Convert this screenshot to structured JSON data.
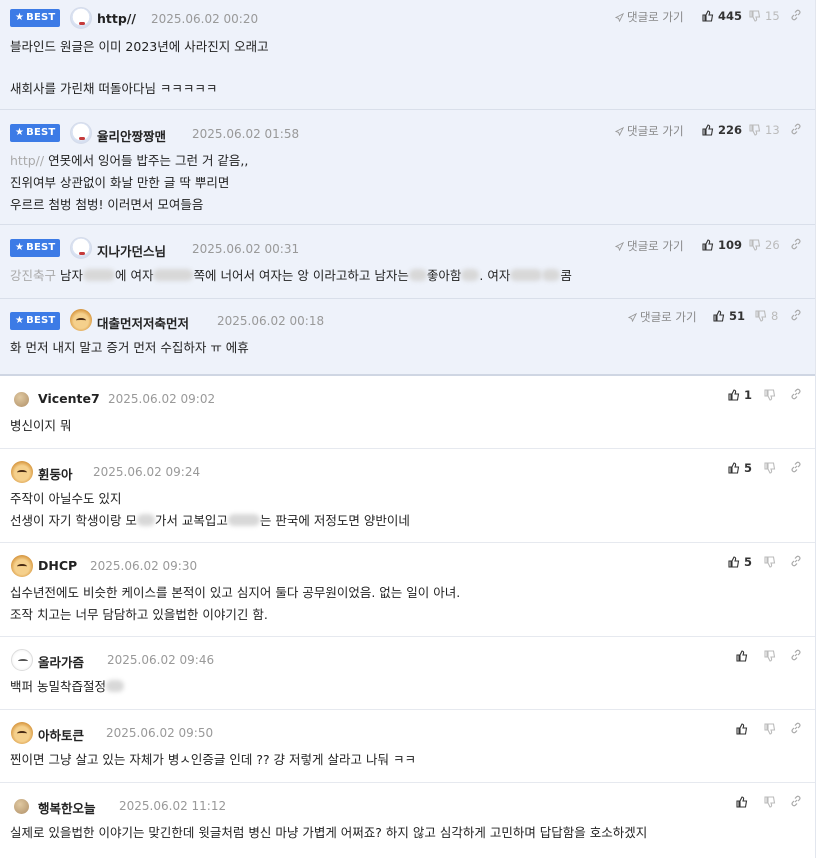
{
  "ui": {
    "best_label": "BEST",
    "reply_label": "댓글로 가기"
  },
  "colors": {
    "best_bg": "#eef2fa",
    "badge": "#3c7be6",
    "separator": "#e6e9ef"
  },
  "best_comments": [
    {
      "nick": "http//",
      "date": "2025.06.02 00:20",
      "likes": "445",
      "dislikes": "15",
      "avatar": "bear",
      "lines": [
        "블라인드 원글은 이미 2023년에 사라진지 오래고",
        "",
        "새회사를 가린채 떠돌아다님 ㅋㅋㅋㅋㅋ"
      ]
    },
    {
      "nick": "율리안짱짱맨",
      "date": "2025.06.02 01:58",
      "likes": "226",
      "dislikes": "13",
      "avatar": "bear",
      "quote": "http//",
      "lines": [
        " 연못에서 잉어들 밥주는 그런 거 같음,,",
        "진위여부 상관없이 화날 만한 글 딱 뿌리면",
        "우르르 첨벙 첨벙! 이러면서 모여들음"
      ]
    },
    {
      "nick": "지나가던스님",
      "date": "2025.06.02 00:31",
      "likes": "109",
      "dislikes": "26",
      "avatar": "bear",
      "quote": "강진축구",
      "lines": [
        " 남자",
        "에 여자",
        "쪽에 너어서 여자는 앙 이라고하고 남자는",
        "좋아함",
        ". 여자",
        "콤"
      ]
    },
    {
      "nick": "대출먼저저축먼저",
      "date": "2025.06.02 00:18",
      "likes": "51",
      "dislikes": "8",
      "avatar": "dog",
      "lines": [
        "화 먼저 내지 말고 증거 먼저 수집하자 ㅠ 에휴"
      ]
    }
  ],
  "comments": [
    {
      "nick": "Vicente7",
      "date": "2025.06.02 09:02",
      "likes": "1",
      "avatar": "ball",
      "lines": [
        "병신이지 뭐"
      ]
    },
    {
      "nick": "휜둥아",
      "date": "2025.06.02 09:24",
      "likes": "5",
      "avatar": "dog",
      "lines": [
        "주작이 아닐수도 있지",
        "선생이 자기 학생이랑 모",
        "가서 교복입고",
        "는 판국에 저정도면 양반이네"
      ]
    },
    {
      "nick": "DHCP",
      "date": "2025.06.02 09:30",
      "likes": "5",
      "avatar": "dog",
      "lines": [
        "십수년전에도 비슷한 케이스를 본적이 있고 심지어 둘다 공무원이었음. 없는 일이 아녀.",
        "조작 치고는 너무 담담하고 있을법한 이야기긴 함."
      ]
    },
    {
      "nick": "올라가즘",
      "date": "2025.06.02 09:46",
      "likes": "",
      "avatar": "white",
      "lines": [
        "백퍼 농밀착즙절정"
      ]
    },
    {
      "nick": "아하토큰",
      "date": "2025.06.02 09:50",
      "likes": "",
      "avatar": "dog",
      "lines": [
        "찐이면 그냥 살고 있는 자체가 병ㅅ인증글 인데 ?? 걍 저렇게 살라고 나둬 ㅋㅋ"
      ]
    },
    {
      "nick": "행복한오늘",
      "date": "2025.06.02 11:12",
      "likes": "",
      "avatar": "ball",
      "lines": [
        "실제로 있을법한 이야기는 맞긴한데 윗글처럼 병신 마냥 가볍게 어쩌죠? 하지 않고 심각하게 고민하며 답답함을 호소하겠지"
      ]
    }
  ]
}
